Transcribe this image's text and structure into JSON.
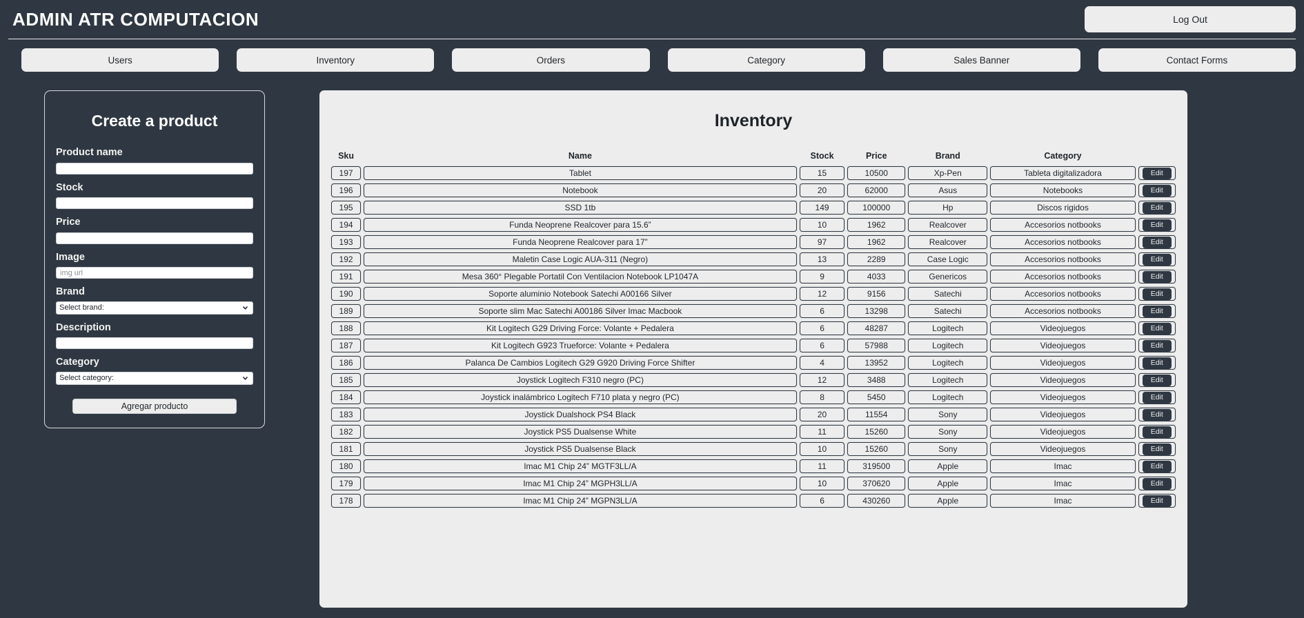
{
  "header": {
    "brand": "ADMIN ATR COMPUTACION",
    "logout_label": "Log Out"
  },
  "nav": {
    "items": [
      {
        "label": "Users"
      },
      {
        "label": "Inventory"
      },
      {
        "label": "Orders"
      },
      {
        "label": "Category"
      },
      {
        "label": "Sales Banner"
      },
      {
        "label": "Contact Forms"
      }
    ]
  },
  "form": {
    "title": "Create a product",
    "submit_label": "Agregar producto",
    "fields": [
      {
        "label": "Product name",
        "type": "text",
        "value": "",
        "placeholder": ""
      },
      {
        "label": "Stock",
        "type": "text",
        "value": "",
        "placeholder": ""
      },
      {
        "label": "Price",
        "type": "text",
        "value": "",
        "placeholder": ""
      },
      {
        "label": "Image",
        "type": "text",
        "value": "",
        "placeholder": "img url"
      },
      {
        "label": "Brand",
        "type": "select",
        "value": "Select brand:"
      },
      {
        "label": "Description",
        "type": "text",
        "value": "",
        "placeholder": ""
      },
      {
        "label": "Category",
        "type": "select",
        "value": "Select category:"
      }
    ]
  },
  "inventory": {
    "title": "Inventory",
    "edit_label": "Edit",
    "columns": [
      "Sku",
      "Name",
      "Stock",
      "Price",
      "Brand",
      "Category",
      ""
    ],
    "rows": [
      {
        "sku": "197",
        "name": "Tablet",
        "stock": "15",
        "price": "10500",
        "brand": "Xp-Pen",
        "category": "Tableta digitalizadora"
      },
      {
        "sku": "196",
        "name": "Notebook",
        "stock": "20",
        "price": "62000",
        "brand": "Asus",
        "category": "Notebooks"
      },
      {
        "sku": "195",
        "name": "SSD 1tb",
        "stock": "149",
        "price": "100000",
        "brand": "Hp",
        "category": "Discos rigidos"
      },
      {
        "sku": "194",
        "name": "Funda Neoprene Realcover para 15.6”",
        "stock": "10",
        "price": "1962",
        "brand": "Realcover",
        "category": "Accesorios notbooks"
      },
      {
        "sku": "193",
        "name": "Funda Neoprene Realcover para 17”",
        "stock": "97",
        "price": "1962",
        "brand": "Realcover",
        "category": "Accesorios notbooks"
      },
      {
        "sku": "192",
        "name": "Maletin Case Logic AUA-311 (Negro)",
        "stock": "13",
        "price": "2289",
        "brand": "Case Logic",
        "category": "Accesorios notbooks"
      },
      {
        "sku": "191",
        "name": "Mesa 360° Plegable Portatil Con Ventilacion Notebook LP1047A",
        "stock": "9",
        "price": "4033",
        "brand": "Genericos",
        "category": "Accesorios notbooks"
      },
      {
        "sku": "190",
        "name": "Soporte aluminio Notebook Satechi A00166 Silver",
        "stock": "12",
        "price": "9156",
        "brand": "Satechi",
        "category": "Accesorios notbooks"
      },
      {
        "sku": "189",
        "name": "Soporte slim Mac Satechi A00186 Silver Imac Macbook",
        "stock": "6",
        "price": "13298",
        "brand": "Satechi",
        "category": "Accesorios notbooks"
      },
      {
        "sku": "188",
        "name": "Kit Logitech G29 Driving Force: Volante + Pedalera",
        "stock": "6",
        "price": "48287",
        "brand": "Logitech",
        "category": "Videojuegos"
      },
      {
        "sku": "187",
        "name": "Kit Logitech G923 Trueforce: Volante + Pedalera",
        "stock": "6",
        "price": "57988",
        "brand": "Logitech",
        "category": "Videojuegos"
      },
      {
        "sku": "186",
        "name": "Palanca De Cambios Logitech G29 G920 Driving Force Shifter",
        "stock": "4",
        "price": "13952",
        "brand": "Logitech",
        "category": "Videojuegos"
      },
      {
        "sku": "185",
        "name": "Joystick Logitech F310 negro (PC)",
        "stock": "12",
        "price": "3488",
        "brand": "Logitech",
        "category": "Videojuegos"
      },
      {
        "sku": "184",
        "name": "Joystick inalámbrico Logitech F710 plata y negro (PC)",
        "stock": "8",
        "price": "5450",
        "brand": "Logitech",
        "category": "Videojuegos"
      },
      {
        "sku": "183",
        "name": "Joystick Dualshock PS4 Black",
        "stock": "20",
        "price": "11554",
        "brand": "Sony",
        "category": "Videojuegos"
      },
      {
        "sku": "182",
        "name": "Joystick PS5 Dualsense White",
        "stock": "11",
        "price": "15260",
        "brand": "Sony",
        "category": "Videojuegos"
      },
      {
        "sku": "181",
        "name": "Joystick PS5 Dualsense Black",
        "stock": "10",
        "price": "15260",
        "brand": "Sony",
        "category": "Videojuegos"
      },
      {
        "sku": "180",
        "name": "Imac M1 Chip 24” MGTF3LL/A",
        "stock": "11",
        "price": "319500",
        "brand": "Apple",
        "category": "Imac"
      },
      {
        "sku": "179",
        "name": "Imac M1 Chip 24” MGPH3LL/A",
        "stock": "10",
        "price": "370620",
        "brand": "Apple",
        "category": "Imac"
      },
      {
        "sku": "178",
        "name": "Imac M1 Chip 24” MGPN3LL/A",
        "stock": "6",
        "price": "430260",
        "brand": "Apple",
        "category": "Imac"
      }
    ]
  },
  "colors": {
    "background": "#2f3842",
    "panel": "#ededed",
    "text_light": "#ffffff",
    "text_dark": "#23282e"
  }
}
